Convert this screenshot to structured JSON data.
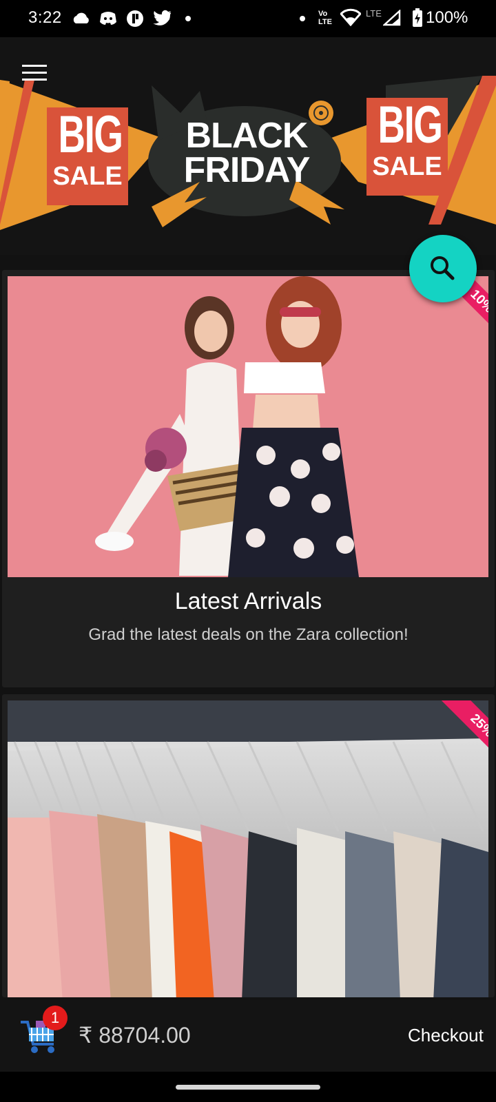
{
  "status_bar": {
    "time": "3:22",
    "battery": "100%",
    "icons": [
      "cloud-icon",
      "discord-icon",
      "app-icon",
      "twitter-icon",
      "dot-icon",
      "dot-icon",
      "volte-icon",
      "wifi-icon",
      "lte-signal-icon",
      "battery-charging-icon"
    ],
    "network_label": "LTE",
    "volte_label_1": "Vo",
    "volte_label_2": "LTE"
  },
  "banner": {
    "big_1": "BIG",
    "sale_1": "SALE",
    "black": "BLACK",
    "friday": "FRIDAY",
    "big_2": "BIG",
    "sale_2": "SALE"
  },
  "cards": [
    {
      "title": "Latest Arrivals",
      "subtitle": "Grad the latest deals on the Zara collection!",
      "ribbon": "10%"
    },
    {
      "title": "",
      "subtitle": "",
      "ribbon": "25%"
    }
  ],
  "cart": {
    "count": "1",
    "total": "₹ 88704.00",
    "checkout_label": "Checkout"
  },
  "colors": {
    "fab": "#14d3c3",
    "ribbon": "#e91e63",
    "badge": "#e31b1b",
    "banner_orange": "#e8972e",
    "banner_red": "#d9533a"
  }
}
